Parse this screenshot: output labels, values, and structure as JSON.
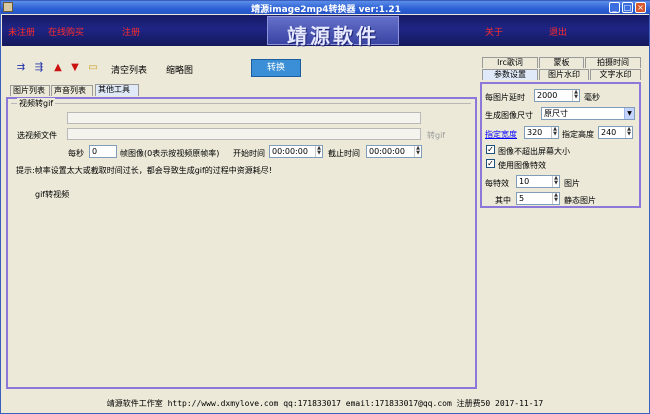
{
  "window": {
    "title": "靖源image2mp4转换器 ver:1.21",
    "min": "_",
    "max": "□",
    "close": "×"
  },
  "banner": {
    "unregistered": "未注册",
    "buy_online": "在线购买",
    "register": "注册",
    "logo": "靖源軟件",
    "about": "关于",
    "exit": "退出"
  },
  "toolbar": {
    "icons": {
      "add": "add-files-icon",
      "add_folder": "add-folder-icon",
      "move_up": "arrow-up-icon",
      "move_down": "arrow-down-icon",
      "open": "open-folder-icon"
    },
    "clear_list": "清空列表",
    "thumbnail": "缩略图",
    "convert": "转换"
  },
  "left_tabs": [
    "图片列表",
    "声音列表",
    "其他工具"
  ],
  "gif_tool": {
    "group_title": "视频转gif",
    "select_video": "选视频文件",
    "to_gif": "转gif",
    "per_second": "每秒",
    "fps_value": "0",
    "frames_note": "帧图像(0表示按视频原帧率)",
    "start_time_label": "开始时间",
    "start_time": "00:00:00",
    "end_time_label": "截止时间",
    "end_time": "00:00:00",
    "tip": "提示:帧率设置太大或截取时间过长，都会导致生成gif的过程中资源耗尽!",
    "status": "gif转视频"
  },
  "right_tabs": {
    "row1": [
      "lrc歌词",
      "蒙板",
      "拍摄时间"
    ],
    "row2": [
      "参数设置",
      "图片水印",
      "文字水印"
    ]
  },
  "settings": {
    "delay_label": "每图片延时",
    "delay_value": "2000",
    "delay_unit": "毫秒",
    "size_label": "生成图像尺寸",
    "size_value": "原尺寸",
    "width_label": "指定宽度",
    "width_value": "320",
    "height_label": "指定高度",
    "height_value": "240",
    "no_exceed_label": "图像不超出屏幕大小",
    "no_exceed_checked": true,
    "effects_label": "使用图像特效",
    "effects_checked": true,
    "per_effect_label": "每特效",
    "per_effect_value": "10",
    "per_effect_unit": "图片",
    "among_label": "其中",
    "among_value": "5",
    "static_label": "静态图片"
  },
  "footer": "靖源软件工作室 http://www.dxmylove.com qq:171833017 email:171833017@qq.com 注册费50 2017-11-17",
  "colors": {
    "accent_border": "#8c78d8",
    "banner_link": "#ff2b2b",
    "convert_button": "#3a8fd6"
  }
}
